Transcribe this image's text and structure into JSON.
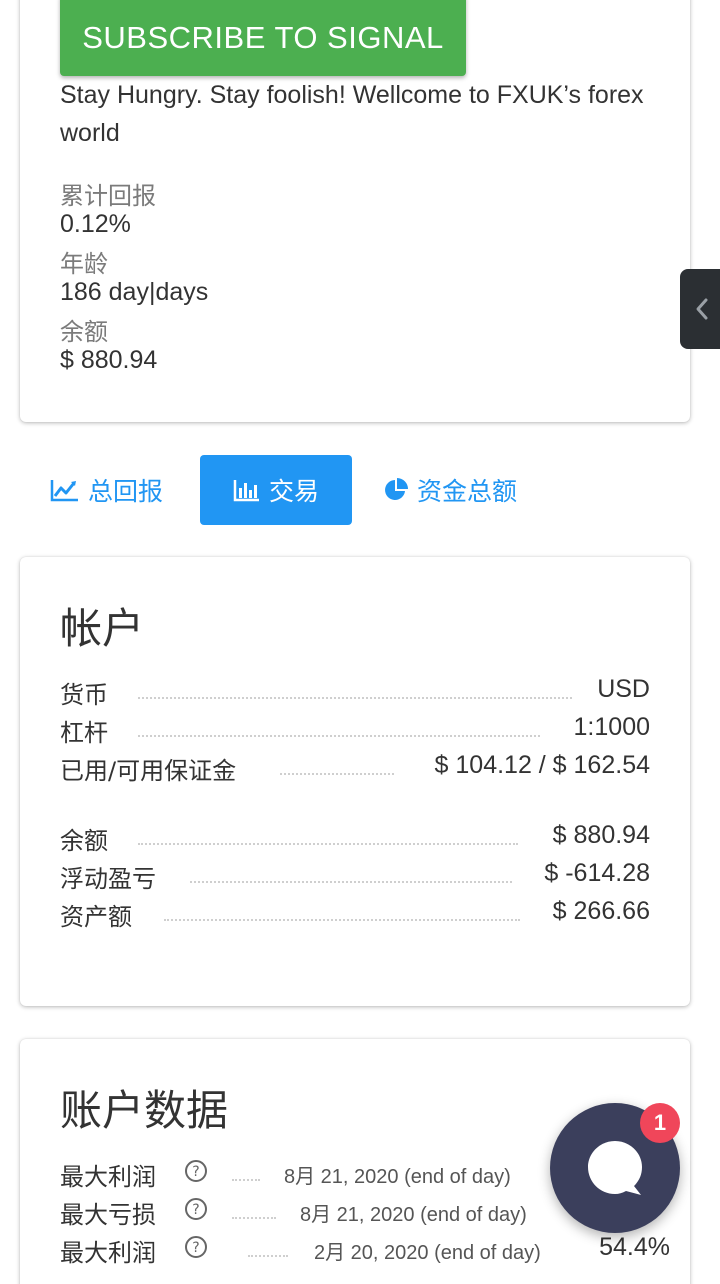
{
  "signal": {
    "subscribe_label": "SUBSCRIBE TO SIGNAL",
    "description": "Stay Hungry. Stay foolish! Wellcome to FXUK’s forex world",
    "stats": [
      {
        "label": "累计回报",
        "value": "0.12%"
      },
      {
        "label": "年龄",
        "value": "186 day|days"
      },
      {
        "label": "余额",
        "value": "$ 880.94"
      }
    ]
  },
  "tabs": [
    {
      "label": "总回报",
      "icon": "line-chart-icon",
      "active": false
    },
    {
      "label": "交易",
      "icon": "bar-chart-icon",
      "active": true
    },
    {
      "label": "资金总额",
      "icon": "pie-chart-icon",
      "active": false
    }
  ],
  "account": {
    "title": "帐户",
    "rows": [
      {
        "label": "货币",
        "value": "USD"
      },
      {
        "label": "杠杆",
        "value": "1:1000"
      },
      {
        "label": "已用/可用保证金",
        "value": "$ 104.12 / $ 162.54"
      },
      {
        "label": "余额",
        "value": "$ 880.94"
      },
      {
        "label": "浮动盈亏",
        "value": "$ -614.28"
      },
      {
        "label": "资产额",
        "value": "$ 266.66"
      }
    ]
  },
  "account_data": {
    "title": "账户数据",
    "rows": [
      {
        "label": "最大利润",
        "date": "8月 21, 2020 (end of day)",
        "value": ""
      },
      {
        "label": "最大亏损",
        "date": "8月 21, 2020 (end of day)",
        "value": ""
      },
      {
        "label": "最大利润",
        "date": "2月 20, 2020 (end of day)",
        "value": "54.4%"
      }
    ]
  },
  "chat": {
    "badge_count": "1"
  },
  "colors": {
    "accent": "#2196f3",
    "subscribe": "#4caf50",
    "badge": "#f0465a",
    "chat": "#3b3f5c"
  }
}
